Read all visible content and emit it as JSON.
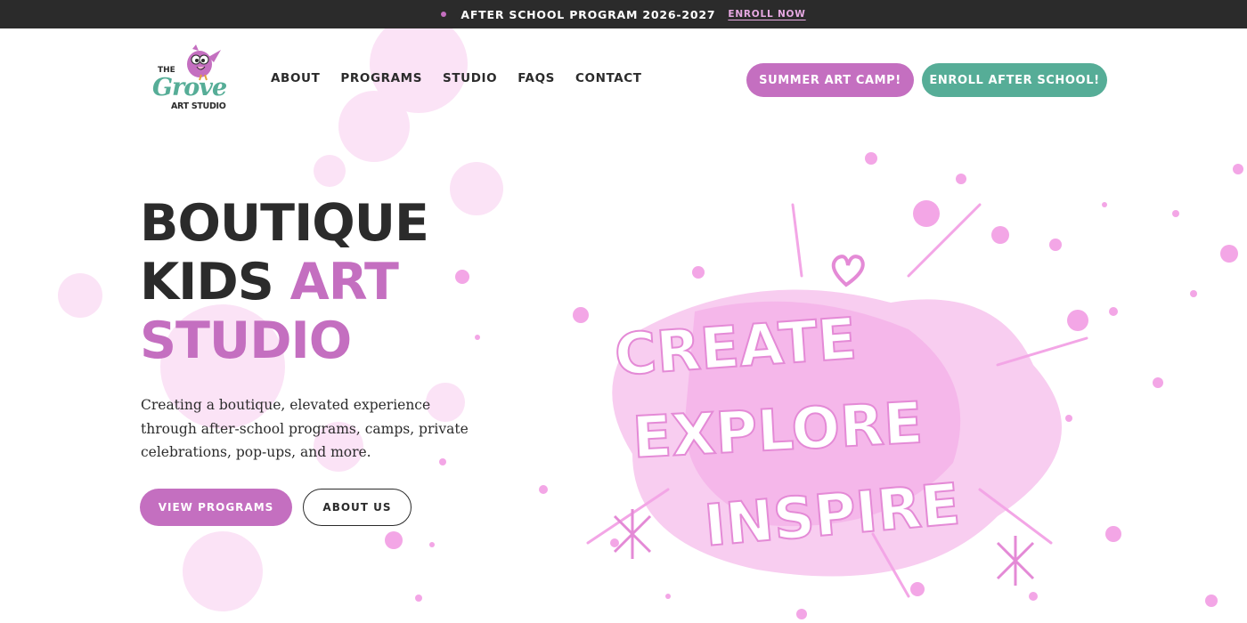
{
  "announcement": {
    "text": "After School Program 2026-2027",
    "link_label": "Enroll Now"
  },
  "logo": {
    "line1": "THE",
    "line2": "Grove",
    "line3": "ART STUDIO"
  },
  "nav": {
    "items": [
      {
        "label": "About"
      },
      {
        "label": "Programs"
      },
      {
        "label": "Studio"
      },
      {
        "label": "FAQs"
      },
      {
        "label": "Contact"
      }
    ]
  },
  "header_buttons": {
    "camp_label": "Summer Art Camp!",
    "enroll_label": "Enroll After School!"
  },
  "hero": {
    "title_line1": "BOUTIQUE",
    "title_line2_dark": "KIDS",
    "title_line2_pink": "ART",
    "title_line3": "STUDIO",
    "description": "Creating a boutique, elevated experience through after-school programs, camps, private celebrations, pop-ups, and more.",
    "primary_cta": "View Programs",
    "secondary_cta": "About us"
  },
  "artwork": {
    "words": [
      "CREATE",
      "EXPLORE",
      "INSPIRE"
    ]
  },
  "colors": {
    "pink": "#c46fc0",
    "green": "#56ad97",
    "dark": "#2b2b2b",
    "splatter": "#f3a6e6"
  },
  "icons": {
    "announcement_dot": "bullet-dot",
    "logo_mascot": "pink-bird-icon",
    "art_heart": "heart-doodle-icon",
    "art_stars": "star-doodle-icon"
  }
}
